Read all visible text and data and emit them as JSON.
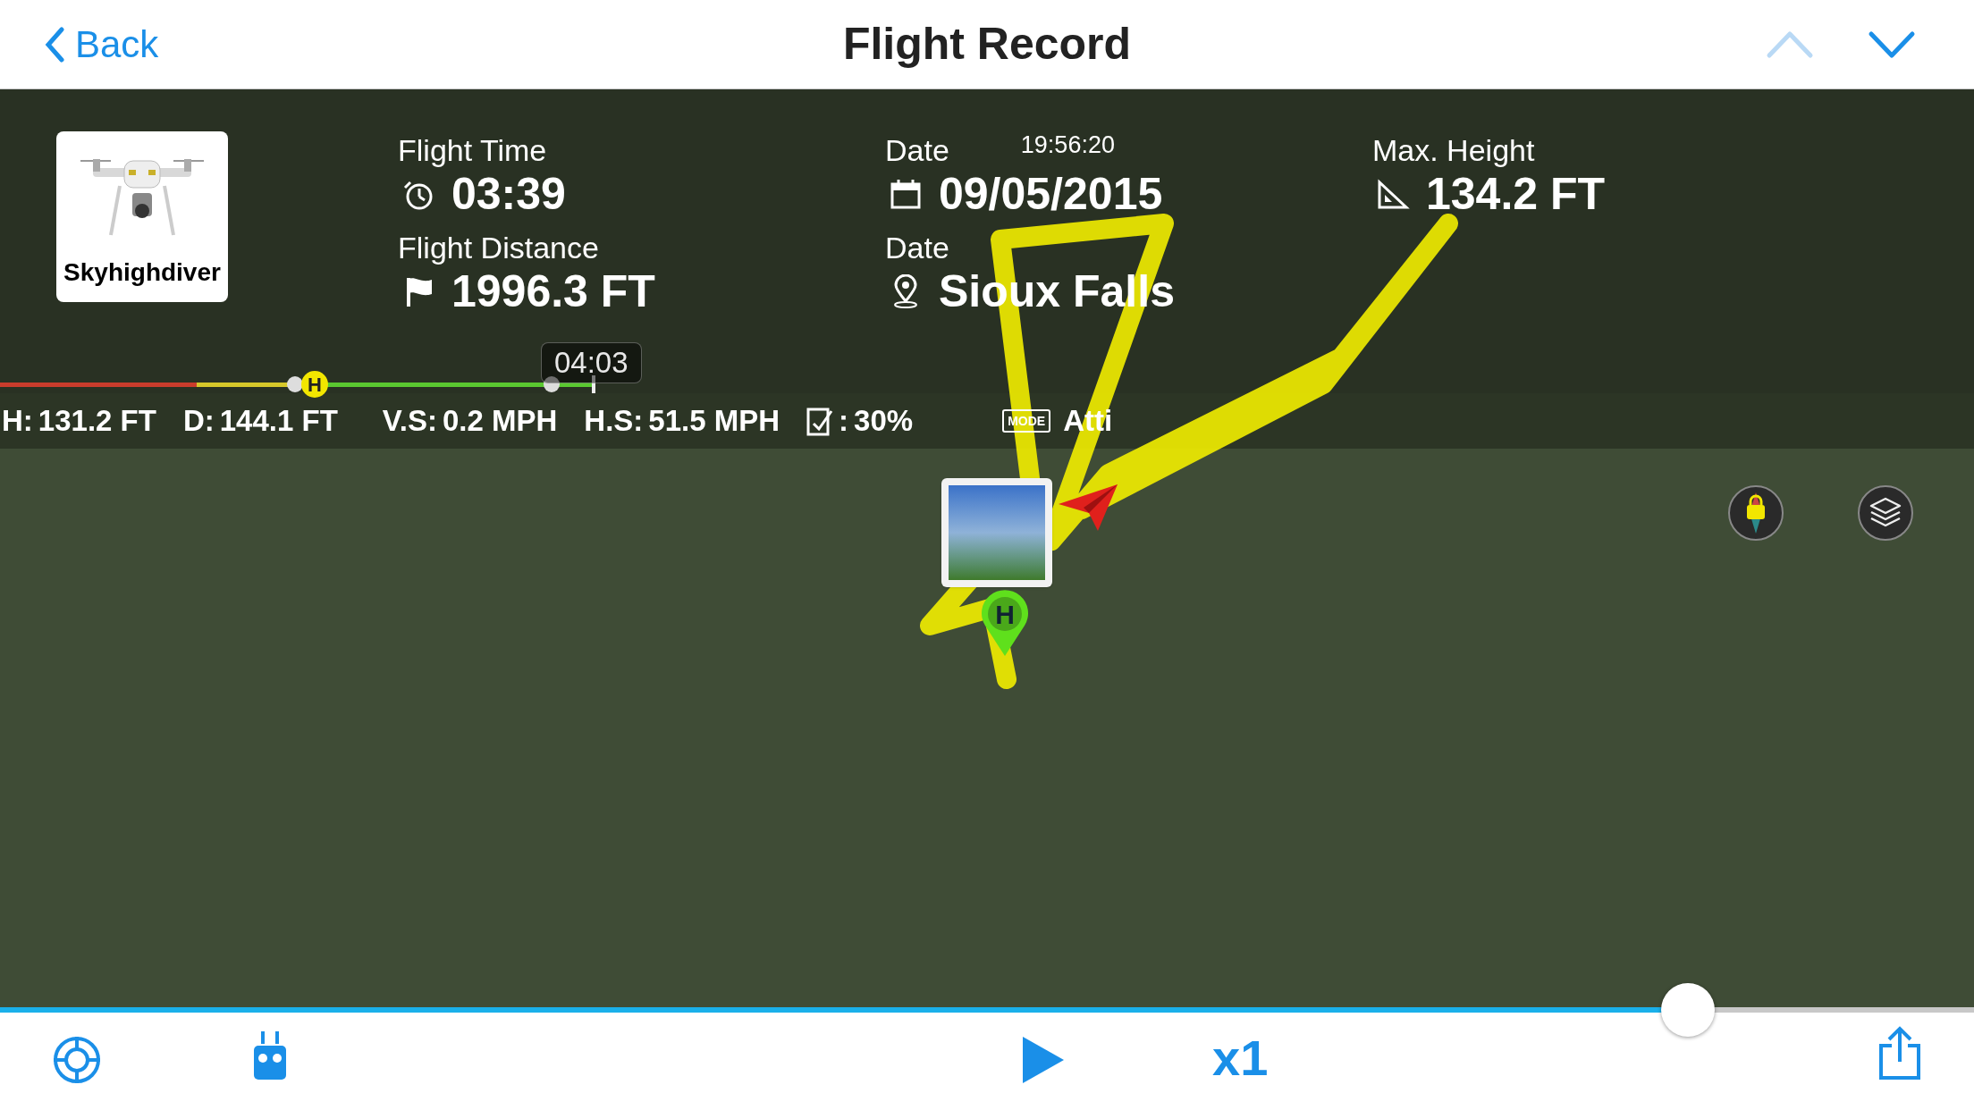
{
  "nav": {
    "back": "Back",
    "title": "Flight Record",
    "arrows": [
      {
        "kind": "up",
        "disabled": true
      },
      {
        "kind": "down",
        "disabled": false
      }
    ]
  },
  "aircraft": {
    "name": "Skyhighdiver"
  },
  "stats": [
    {
      "kind": "time",
      "label": "Flight Time",
      "value": "03:39"
    },
    {
      "kind": "date",
      "label": "Date",
      "value": "09/05/2015",
      "time": "19:56:20"
    },
    {
      "kind": "height",
      "label": "Max. Height",
      "value": "134.2 FT"
    },
    {
      "kind": "distance",
      "label": "Flight Distance",
      "value": "1996.3 FT"
    },
    {
      "kind": "place",
      "label": "Date",
      "value": "Sioux Falls"
    }
  ],
  "timeline": {
    "time": "04:03",
    "home_mark": "H"
  },
  "home_pin": {
    "label": "H"
  },
  "telemetry": [
    {
      "kind": "text",
      "label": "H:",
      "value": "131.2 FT"
    },
    {
      "kind": "text",
      "label": "D:",
      "value": "144.1 FT"
    },
    {
      "kind": "text",
      "label": "V.S:",
      "value": "0.2 MPH"
    },
    {
      "kind": "text",
      "label": "H.S:",
      "value": "51.5 MPH"
    },
    {
      "kind": "battery",
      "label": ":",
      "value": "30%"
    },
    {
      "kind": "mode",
      "label": "MODE",
      "value": "Atti"
    }
  ],
  "playback": {
    "level": 0.855,
    "speed": "x1"
  }
}
